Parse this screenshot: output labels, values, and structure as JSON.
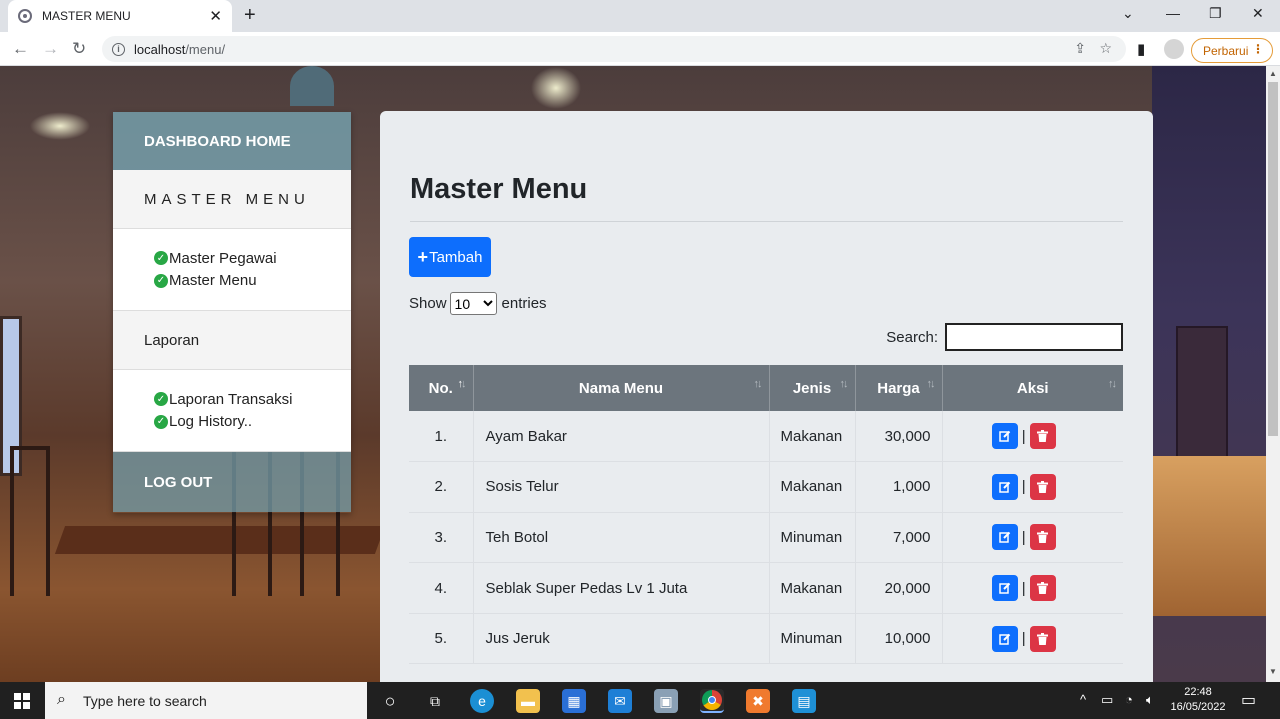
{
  "browser": {
    "tab_title": "MASTER MENU",
    "url_host": "localhost",
    "url_path": "/menu/",
    "update_label": "Perbarui"
  },
  "sidebar": {
    "dashboard_label": "DASHBOARD HOME",
    "master_heading": "MASTER MENU",
    "master_items": [
      {
        "label": "Master Pegawai"
      },
      {
        "label": "Master Menu"
      }
    ],
    "laporan_heading": "Laporan",
    "laporan_items": [
      {
        "label": "Laporan Transaksi"
      },
      {
        "label": "Log History.."
      }
    ],
    "logout_label": "LOG OUT"
  },
  "main": {
    "title": "Master Menu",
    "add_button": "Tambah",
    "show_label": "Show",
    "entries_value": "10",
    "entries_label": "entries",
    "search_label": "Search:",
    "columns": [
      "No.",
      "Nama Menu",
      "Jenis",
      "Harga",
      "Aksi"
    ],
    "rows": [
      {
        "no": "1.",
        "nama": "Ayam Bakar",
        "jenis": "Makanan",
        "harga": "30,000"
      },
      {
        "no": "2.",
        "nama": "Sosis Telur",
        "jenis": "Makanan",
        "harga": "1,000"
      },
      {
        "no": "3.",
        "nama": "Teh Botol",
        "jenis": "Minuman",
        "harga": "7,000"
      },
      {
        "no": "4.",
        "nama": "Seblak Super Pedas Lv 1 Juta",
        "jenis": "Makanan",
        "harga": "20,000"
      },
      {
        "no": "5.",
        "nama": "Jus Jeruk",
        "jenis": "Minuman",
        "harga": "10,000"
      }
    ],
    "action_separator": "|"
  },
  "taskbar": {
    "search_placeholder": "Type here to search",
    "time": "22:48",
    "date": "16/05/2022"
  },
  "colors": {
    "primary": "#0d6efd",
    "danger": "#dc3545",
    "success": "#28a745",
    "table_header": "#6c757d"
  }
}
